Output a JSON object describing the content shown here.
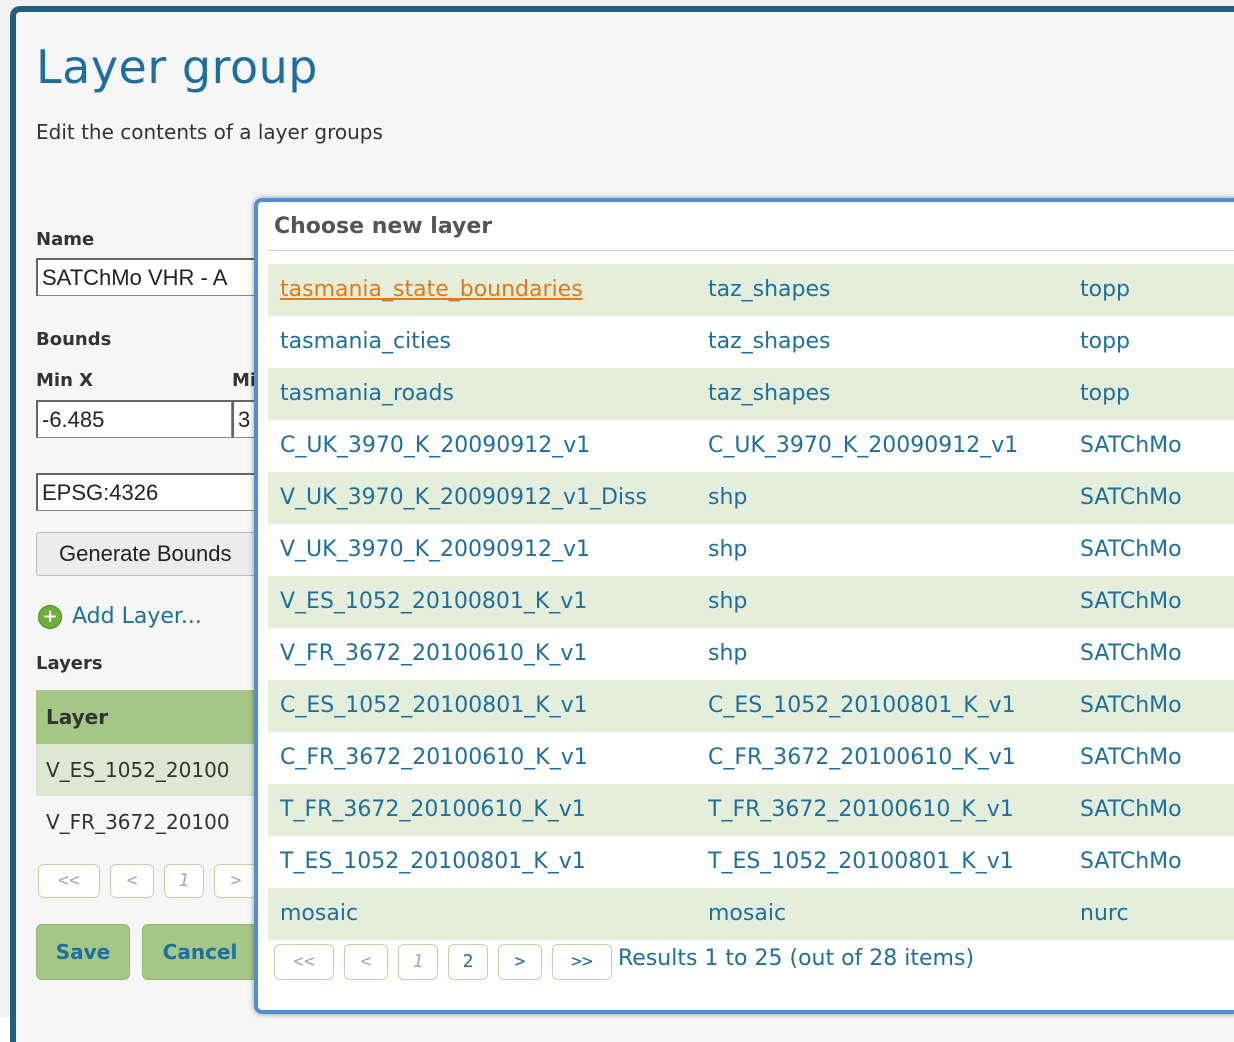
{
  "page": {
    "title": "Layer group",
    "subtitle": "Edit the contents of a layer groups"
  },
  "form": {
    "name_label": "Name",
    "name_value": "SATChMo VHR - A",
    "bounds_label": "Bounds",
    "minx_label": "Min X",
    "miny_label": "Mi",
    "minx_value": "-6.485",
    "miny_value": "3",
    "srs_value": "EPSG:4326",
    "generate_bounds_label": "Generate Bounds",
    "add_layer_label": "Add Layer...",
    "layers_label": "Layers",
    "layers_header": "Layer",
    "layers": [
      "V_ES_1052_20100",
      "V_FR_3672_20100"
    ],
    "pager": [
      "<<",
      "<",
      "1",
      ">"
    ],
    "save_label": "Save",
    "cancel_label": "Cancel"
  },
  "modal": {
    "title": "Choose new layer",
    "rows": [
      {
        "name": "tasmania_state_boundaries",
        "store": "taz_shapes",
        "workspace": "topp"
      },
      {
        "name": "tasmania_cities",
        "store": "taz_shapes",
        "workspace": "topp"
      },
      {
        "name": "tasmania_roads",
        "store": "taz_shapes",
        "workspace": "topp"
      },
      {
        "name": "C_UK_3970_K_20090912_v1",
        "store": "C_UK_3970_K_20090912_v1",
        "workspace": "SATChMo"
      },
      {
        "name": "V_UK_3970_K_20090912_v1_Diss",
        "store": "shp",
        "workspace": "SATChMo"
      },
      {
        "name": "V_UK_3970_K_20090912_v1",
        "store": "shp",
        "workspace": "SATChMo"
      },
      {
        "name": "V_ES_1052_20100801_K_v1",
        "store": "shp",
        "workspace": "SATChMo"
      },
      {
        "name": "V_FR_3672_20100610_K_v1",
        "store": "shp",
        "workspace": "SATChMo"
      },
      {
        "name": "C_ES_1052_20100801_K_v1",
        "store": "C_ES_1052_20100801_K_v1",
        "workspace": "SATChMo"
      },
      {
        "name": "C_FR_3672_20100610_K_v1",
        "store": "C_FR_3672_20100610_K_v1",
        "workspace": "SATChMo"
      },
      {
        "name": "T_FR_3672_20100610_K_v1",
        "store": "T_FR_3672_20100610_K_v1",
        "workspace": "SATChMo"
      },
      {
        "name": "T_ES_1052_20100801_K_v1",
        "store": "T_ES_1052_20100801_K_v1",
        "workspace": "SATChMo"
      },
      {
        "name": "mosaic",
        "store": "mosaic",
        "workspace": "nurc"
      }
    ],
    "pager": [
      "<<",
      "<",
      "1",
      "2",
      ">",
      ">>"
    ],
    "results_text": "Results 1 to 25 (out of 28 items)"
  },
  "colors": {
    "accent": "#1e6f9f",
    "frame": "#1f5f7f",
    "row_shade": "#e4eedb",
    "header_green": "#a5c786",
    "link_hover": "#e07a17",
    "modal_border": "#4f8fd3"
  }
}
